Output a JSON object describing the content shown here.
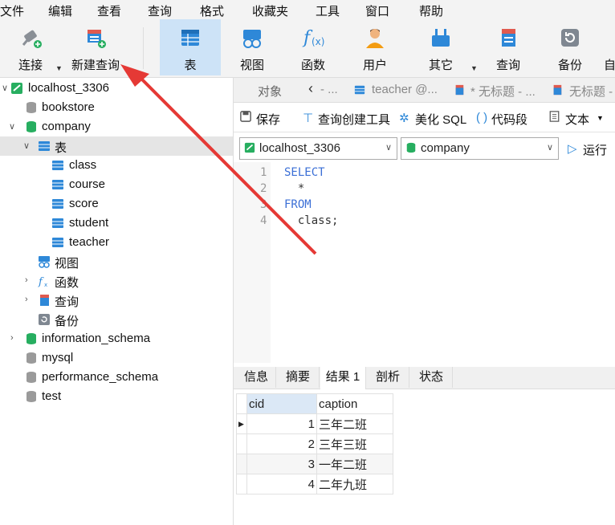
{
  "menu": [
    "文件",
    "编辑",
    "查看",
    "查询",
    "格式",
    "收藏夹",
    "工具",
    "窗口",
    "帮助"
  ],
  "toolbar": {
    "connect": "连接",
    "new_query": "新建查询",
    "table": "表",
    "view": "视图",
    "function": "函数",
    "user": "用户",
    "other": "其它",
    "query": "查询",
    "backup": "备份",
    "partial": "自"
  },
  "tree": {
    "connection": "localhost_3306",
    "databases": {
      "bookstore": "bookstore",
      "company": "company",
      "information_schema": "information_schema",
      "mysql": "mysql",
      "performance_schema": "performance_schema",
      "test": "test"
    },
    "tables_folder": "表",
    "tables": [
      "class",
      "course",
      "score",
      "student",
      "teacher"
    ],
    "views": "视图",
    "functions": "函数",
    "queries": "查询",
    "backups": "备份"
  },
  "tabs": {
    "objects": "对象",
    "t1": "- ...",
    "t2": "teacher @...",
    "t3": "* 无标题 - ...",
    "t4": "无标题 -"
  },
  "query_toolbar": {
    "save": "保存",
    "builder": "查询创建工具",
    "beautify": "美化 SQL",
    "snippet": "代码段",
    "text": "文本"
  },
  "connection_select": "localhost_3306",
  "database_select": "company",
  "run": "运行",
  "editor": {
    "line_numbers": [
      "1",
      "2",
      "3",
      "4"
    ],
    "lines": [
      "SELECT",
      "  *",
      "FROM",
      "  class;"
    ]
  },
  "result_tabs": [
    "信息",
    "摘要",
    "结果 1",
    "剖析",
    "状态"
  ],
  "result": {
    "columns": [
      "cid",
      "caption"
    ],
    "rows": [
      [
        "1",
        "三年二班"
      ],
      [
        "2",
        "三年三班"
      ],
      [
        "3",
        "一年二班"
      ],
      [
        "4",
        "二年九班"
      ]
    ]
  },
  "colors": {
    "accent": "#2e88d8",
    "db_green": "#27ae60",
    "arrow": "#e53935"
  }
}
